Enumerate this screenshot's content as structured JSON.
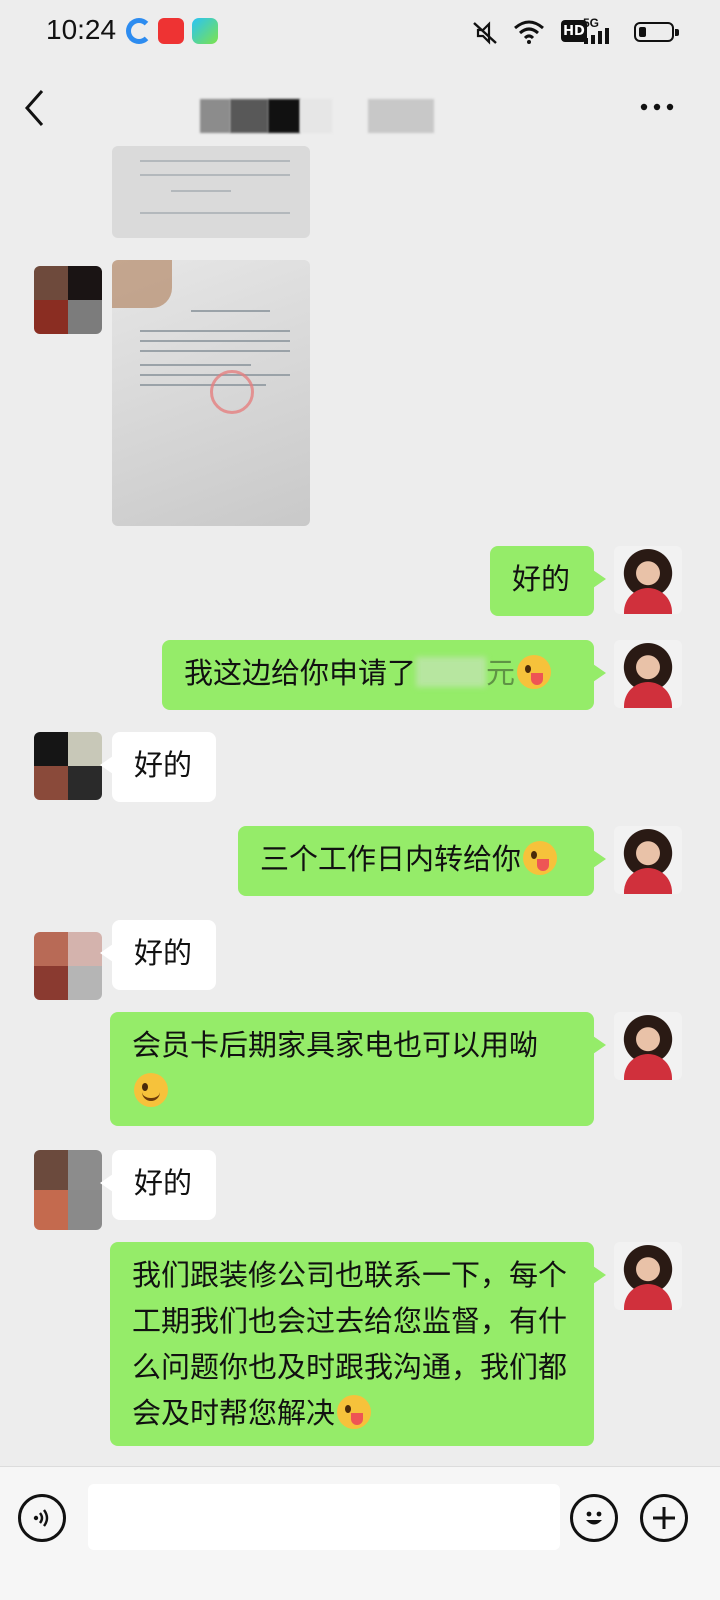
{
  "status_bar": {
    "time": "10:24",
    "hd": "HD",
    "network": "5G"
  },
  "nav": {
    "back_icon": "chevron-left-icon",
    "more_icon": "more-dots-icon"
  },
  "messages": [
    {
      "side": "me",
      "text": "好的",
      "emoji": ""
    },
    {
      "side": "me",
      "text": "我这边给你申请了",
      "suffix": "元",
      "emoji": "wink"
    },
    {
      "side": "other",
      "text": "好的"
    },
    {
      "side": "me",
      "text": "三个工作日内转给你",
      "emoji": "wink"
    },
    {
      "side": "other",
      "text": "好的"
    },
    {
      "side": "me",
      "text": "会员卡后期家具家电也可以用呦",
      "emoji": "smile"
    },
    {
      "side": "other",
      "text": "好的"
    },
    {
      "side": "me",
      "text": "我们跟装修公司也联系一下，每个工期我们也会过去给您监督，有什么问题你也及时跟我沟通，我们都会及时帮您解决",
      "emoji": "wink"
    }
  ],
  "input": {
    "voice_icon": "voice-icon",
    "emoji_icon": "emoji-icon",
    "plus_icon": "plus-icon"
  },
  "colors": {
    "my_bubble": "#95ec69",
    "other_bubble": "#ffffff",
    "background": "#ededed"
  }
}
